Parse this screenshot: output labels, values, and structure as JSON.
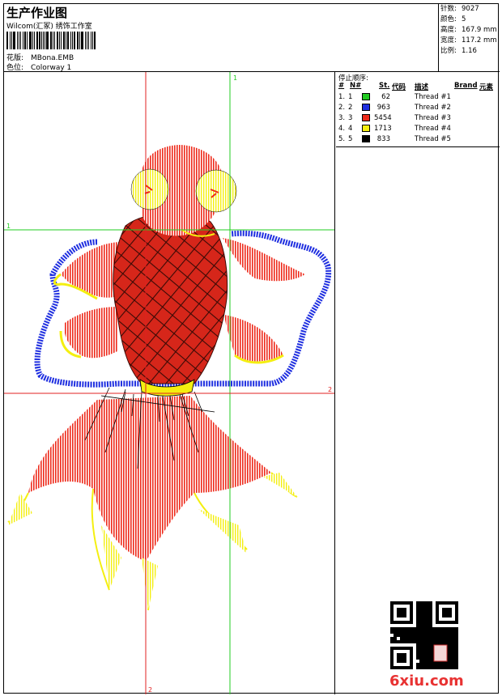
{
  "header": {
    "title": "生产作业图",
    "company": "Wilcom(汇冢) 绣饰工作室",
    "design_label": "花版:",
    "design_file": "MBona.EMB",
    "color_label": "色位:",
    "colorway": "Colorway 1"
  },
  "stats": [
    {
      "label": "针数:",
      "value": "9027"
    },
    {
      "label": "颜色:",
      "value": "5"
    },
    {
      "label": "高度:",
      "value": "167.9 mm"
    },
    {
      "label": "宽度:",
      "value": "117.2 mm"
    },
    {
      "label": "比例:",
      "value": "1.16"
    }
  ],
  "stop_sequence": {
    "title": "停止顺序:",
    "headers": {
      "num": "#",
      "n": "N#",
      "st": "St.",
      "code": "代码",
      "desc": "描述",
      "brand": "Brand",
      "element": "元素"
    },
    "rows": [
      {
        "num": "1.",
        "n": "1",
        "color": "#22cc22",
        "stitches": "62",
        "desc": "Thread #1"
      },
      {
        "num": "2.",
        "n": "2",
        "color": "#1f2fe0",
        "stitches": "963",
        "desc": "Thread #2"
      },
      {
        "num": "3.",
        "n": "3",
        "color": "#ee2a1b",
        "stitches": "5454",
        "desc": "Thread #3"
      },
      {
        "num": "4.",
        "n": "4",
        "color": "#f4ef10",
        "stitches": "1713",
        "desc": "Thread #4"
      },
      {
        "num": "5.",
        "n": "5",
        "color": "#000000",
        "stitches": "833",
        "desc": "Thread #5"
      }
    ]
  },
  "guides": {
    "green_v": "1",
    "green_h": "1",
    "red_h": "2",
    "red_v": "2"
  },
  "watermark": "6xiu.com"
}
